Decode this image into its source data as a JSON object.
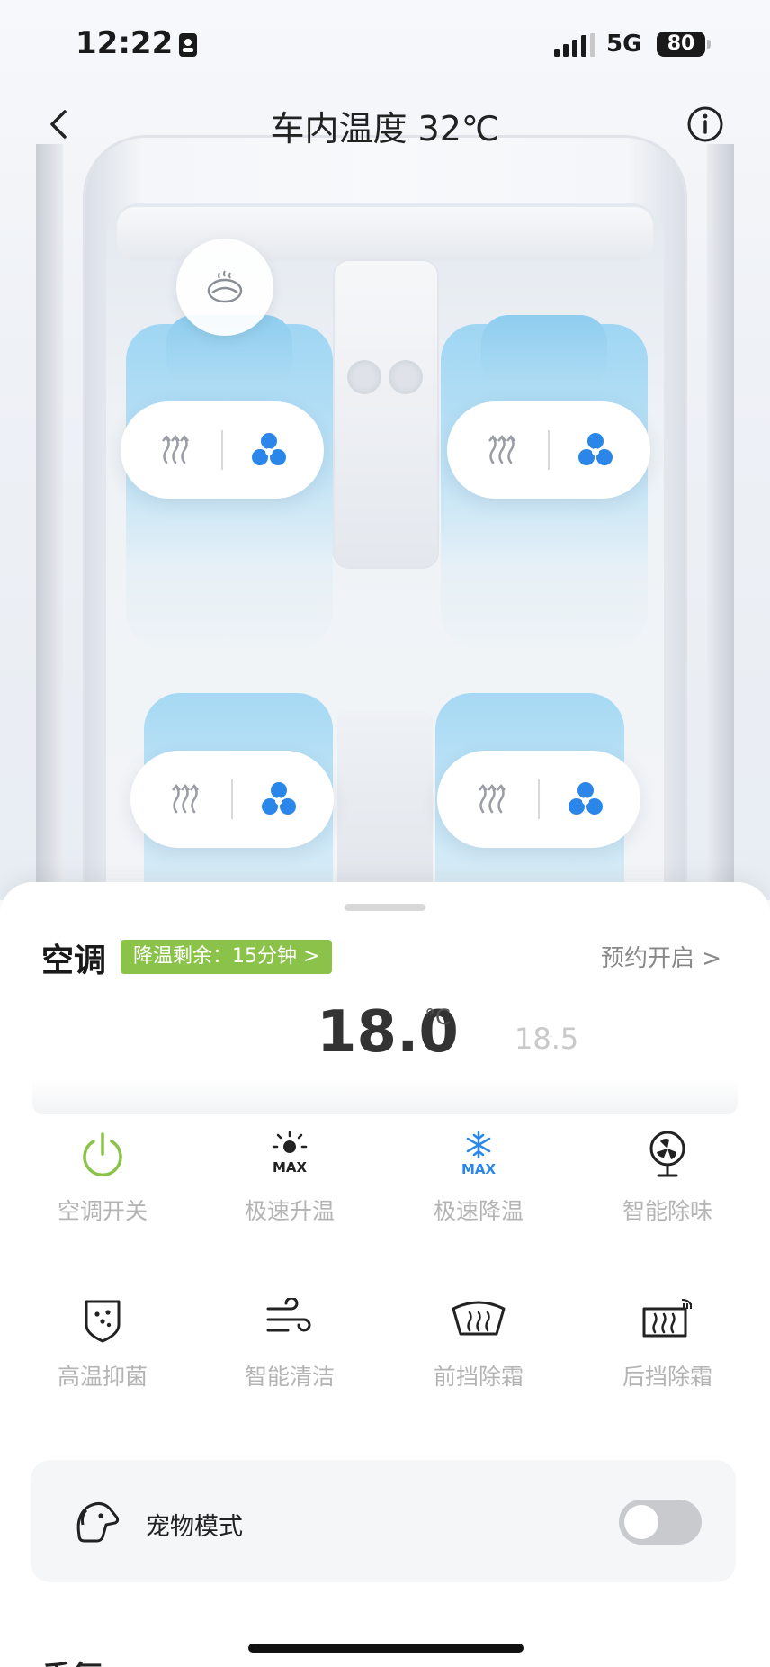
{
  "status_bar": {
    "time": "12:22",
    "network": "5G",
    "battery": "80"
  },
  "header": {
    "title": "车内温度 32℃"
  },
  "seats": {
    "front_left": {
      "heat_icon": "heat-icon",
      "fan_icon": "fan-icon"
    },
    "front_right": {
      "heat_icon": "heat-icon",
      "fan_icon": "fan-icon"
    },
    "rear_left": {
      "heat_icon": "heat-icon",
      "fan_icon": "fan-icon"
    },
    "rear_right": {
      "heat_icon": "heat-icon",
      "fan_icon": "fan-icon"
    }
  },
  "ac": {
    "title": "空调",
    "cooldown_label": "降温剩余：15分钟 >",
    "schedule_label": "预约开启 >",
    "temp_current": "18.0",
    "temp_unit": "°C",
    "temp_next": "18.5"
  },
  "functions": [
    {
      "label": "空调开关",
      "icon": "power-icon"
    },
    {
      "label": "极速升温",
      "icon": "sun-max-icon"
    },
    {
      "label": "极速降温",
      "icon": "snowflake-max-icon"
    },
    {
      "label": "智能除味",
      "icon": "fan-deodorize-icon"
    },
    {
      "label": "高温抑菌",
      "icon": "shield-sterilize-icon"
    },
    {
      "label": "智能清洁",
      "icon": "wind-clean-icon"
    },
    {
      "label": "前挡除霜",
      "icon": "front-defrost-icon"
    },
    {
      "label": "后挡除霜",
      "icon": "rear-defrost-icon"
    }
  ],
  "pet_mode": {
    "label": "宠物模式",
    "enabled": false
  },
  "next_section": {
    "label": "香氛"
  },
  "colors": {
    "accent_blue": "#2a86e8",
    "power_green": "#8bc34a",
    "badge_green": "#8bc34a",
    "seat_blue": "#9fd6f3"
  }
}
